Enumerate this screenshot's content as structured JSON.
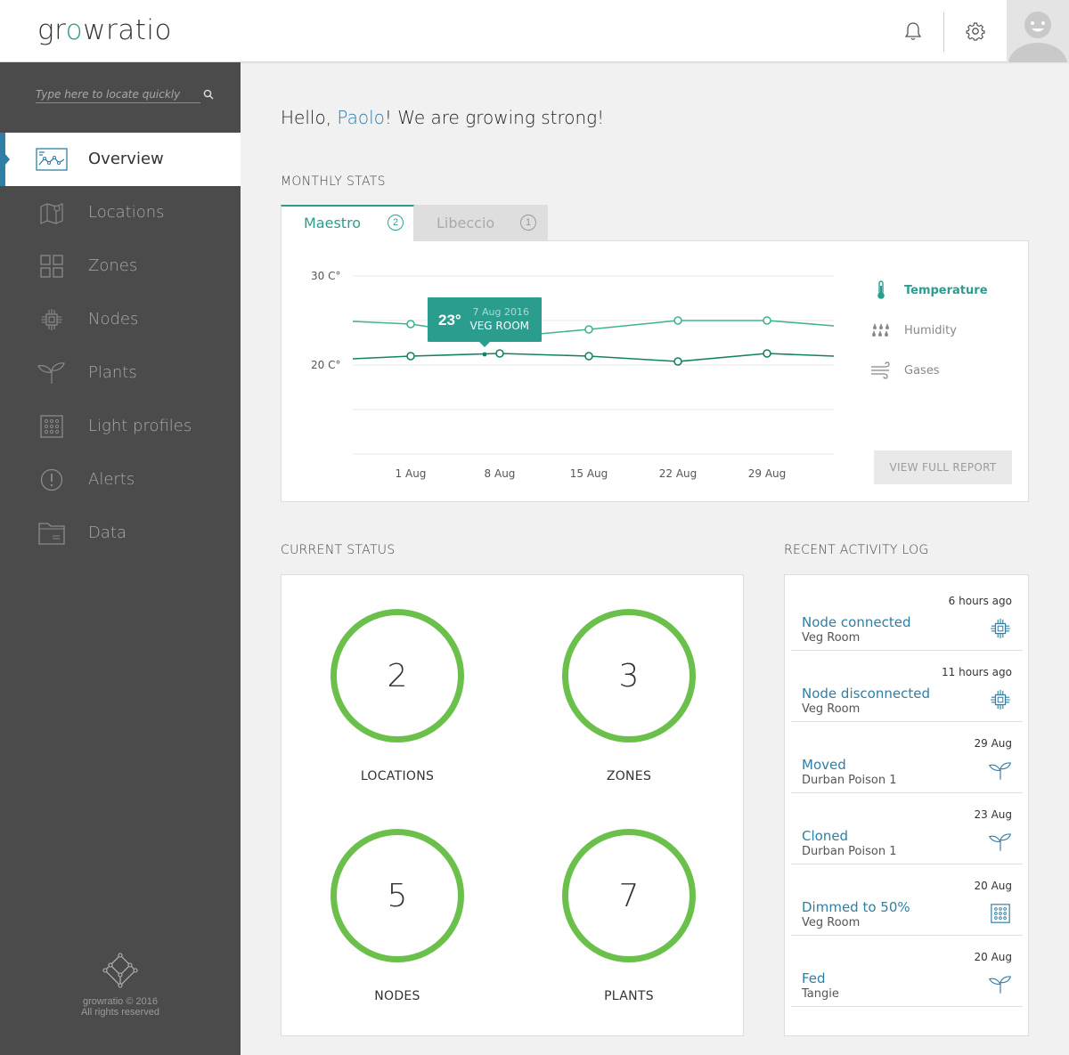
{
  "header": {
    "logo": {
      "part1": "gr",
      "accent": "o",
      "part2": "wratio"
    },
    "icons": [
      "bell-icon",
      "gear-icon"
    ],
    "avatar": "user-avatar"
  },
  "sidebar": {
    "search_placeholder": "Type here to locate quickly",
    "items": [
      {
        "label": "Overview",
        "icon": "chart-icon",
        "active": true
      },
      {
        "label": "Locations",
        "icon": "map-icon"
      },
      {
        "label": "Zones",
        "icon": "grid-icon"
      },
      {
        "label": "Nodes",
        "icon": "chip-icon"
      },
      {
        "label": "Plants",
        "icon": "plant-icon"
      },
      {
        "label": "Light profiles",
        "icon": "light-panel-icon"
      },
      {
        "label": "Alerts",
        "icon": "alert-icon"
      },
      {
        "label": "Data",
        "icon": "folder-icon"
      }
    ],
    "footer": {
      "copyright": "growratio © 2016",
      "rights": "All rights reserved"
    }
  },
  "main": {
    "greeting": {
      "prefix": "Hello, ",
      "name": "Paolo",
      "suffix": "! We are growing strong!"
    },
    "monthly_stats_title": "MONTHLY STATS",
    "tabs": [
      {
        "label": "Maestro",
        "count": "2",
        "active": true
      },
      {
        "label": "Libeccio",
        "count": "1",
        "active": false
      }
    ],
    "legend": [
      {
        "label": "Temperature",
        "icon": "thermometer-icon",
        "active": true
      },
      {
        "label": "Humidity",
        "icon": "raindrops-icon"
      },
      {
        "label": "Gases",
        "icon": "wind-icon"
      }
    ],
    "report_button": "VIEW FULL REPORT",
    "tooltip": {
      "value": "23°",
      "date": "7 Aug 2016",
      "location": "VEG ROOM"
    },
    "current_status_title": "CURRENT STATUS",
    "status": [
      {
        "label": "LOCATIONS",
        "value": "2"
      },
      {
        "label": "ZONES",
        "value": "3"
      },
      {
        "label": "NODES",
        "value": "5"
      },
      {
        "label": "PLANTS",
        "value": "7"
      }
    ],
    "activity_title": "RECENT ACTIVITY LOG",
    "activity": [
      {
        "time": "6 hours ago",
        "title": "Node connected",
        "subtitle": "Veg Room",
        "icon": "chip-icon"
      },
      {
        "time": "11 hours ago",
        "title": "Node disconnected",
        "subtitle": "Veg Room",
        "icon": "chip-icon"
      },
      {
        "time": "29 Aug",
        "title": "Moved",
        "subtitle": "Durban Poison 1",
        "icon": "plant-icon"
      },
      {
        "time": "23 Aug",
        "title": "Cloned",
        "subtitle": "Durban Poison 1",
        "icon": "plant-icon"
      },
      {
        "time": "20 Aug",
        "title": "Dimmed to 50%",
        "subtitle": "Veg Room",
        "icon": "light-panel-icon"
      },
      {
        "time": "20 Aug",
        "title": "Fed",
        "subtitle": "Tangie",
        "icon": "plant-icon"
      }
    ]
  },
  "chart_data": {
    "type": "line",
    "x": [
      "1 Aug",
      "8 Aug",
      "15 Aug",
      "22 Aug",
      "29 Aug"
    ],
    "y_ticks": [
      "30 C°",
      "20 C°"
    ],
    "ylim": [
      10,
      30
    ],
    "grid": true,
    "series": [
      {
        "values": [
          24.9,
          24.6,
          23.1,
          24.0,
          25.0,
          25.0,
          24.4
        ],
        "x_positions": [
          "",
          "1 Aug",
          "8 Aug",
          "15 Aug",
          "22 Aug",
          "29 Aug",
          ""
        ],
        "color": "#3fb393"
      },
      {
        "values": [
          20.7,
          21.0,
          21.3,
          21.0,
          20.4,
          21.3,
          21.0
        ],
        "x_positions": [
          "",
          "1 Aug",
          "8 Aug",
          "15 Aug",
          "22 Aug",
          "29 Aug",
          ""
        ],
        "color": "#138262"
      }
    ],
    "colors": {
      "accent": "#2a9d8f",
      "tooltip_bg": "#2a9d8f"
    }
  }
}
